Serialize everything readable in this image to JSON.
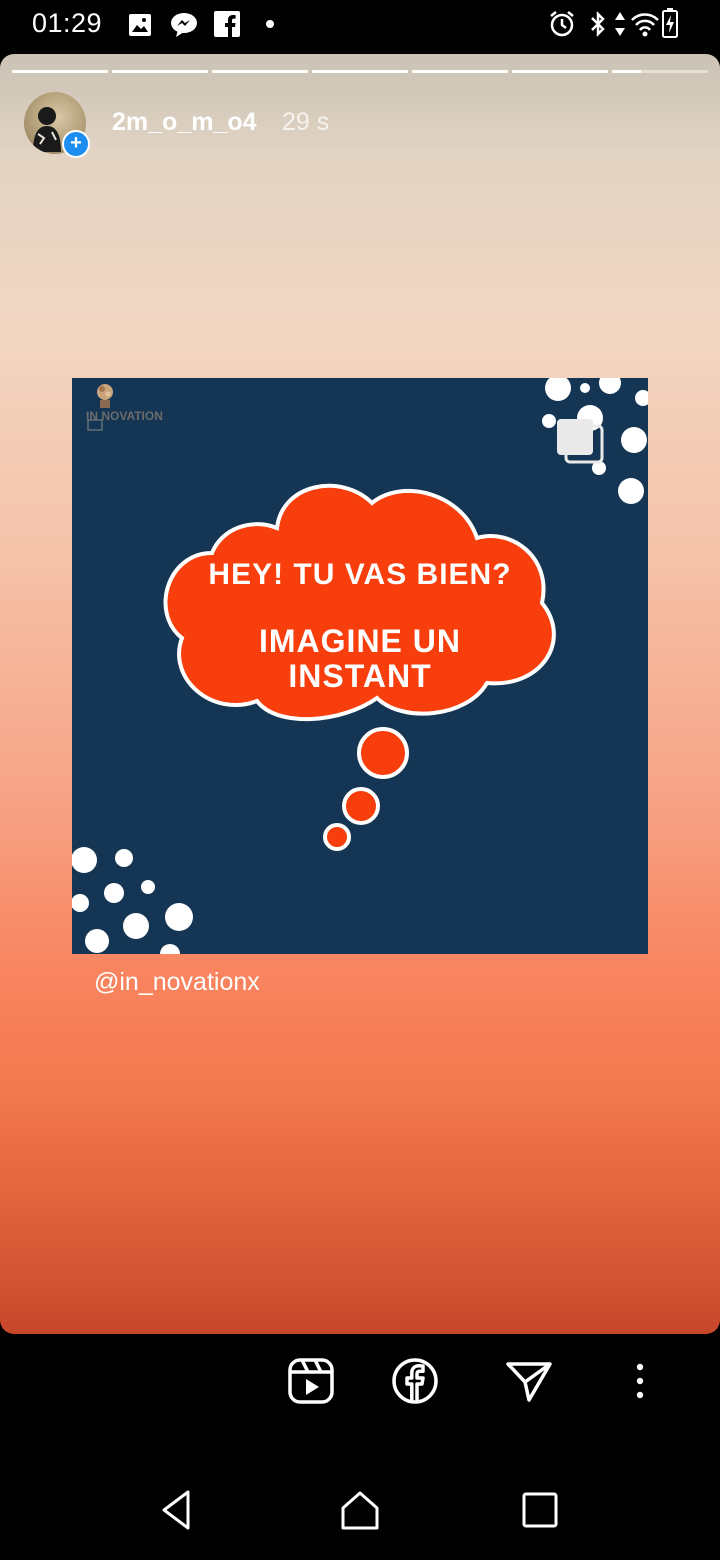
{
  "status_bar": {
    "time": "01:29",
    "left_icons": [
      "gallery-icon",
      "messenger-icon",
      "facebook-icon",
      "notification-dot-icon"
    ],
    "right_icons": [
      "alarm-icon",
      "bluetooth-icon",
      "data-arrows-icon",
      "wifi-icon",
      "battery-charging-icon"
    ]
  },
  "story": {
    "segments_total": 7,
    "segment_current": 7,
    "current_segment_progress": 0.3,
    "username": "2m_o_m_o4",
    "time_ago": "29 s",
    "post": {
      "logo_text": "IN NOVATION",
      "bubble_line1": "HEY! TU VAS BIEN?",
      "bubble_line2": "IMAGINE UN",
      "bubble_line3": "INSTANT",
      "accent_color": "#f73e0c",
      "background_color": "#143654"
    },
    "mention": "@in_novationx"
  },
  "actions": {
    "icons": [
      "reels-icon",
      "facebook-share-icon",
      "send-icon",
      "more-options-icon"
    ]
  },
  "navigation": {
    "icons": [
      "back-icon",
      "home-icon",
      "recents-icon"
    ]
  }
}
